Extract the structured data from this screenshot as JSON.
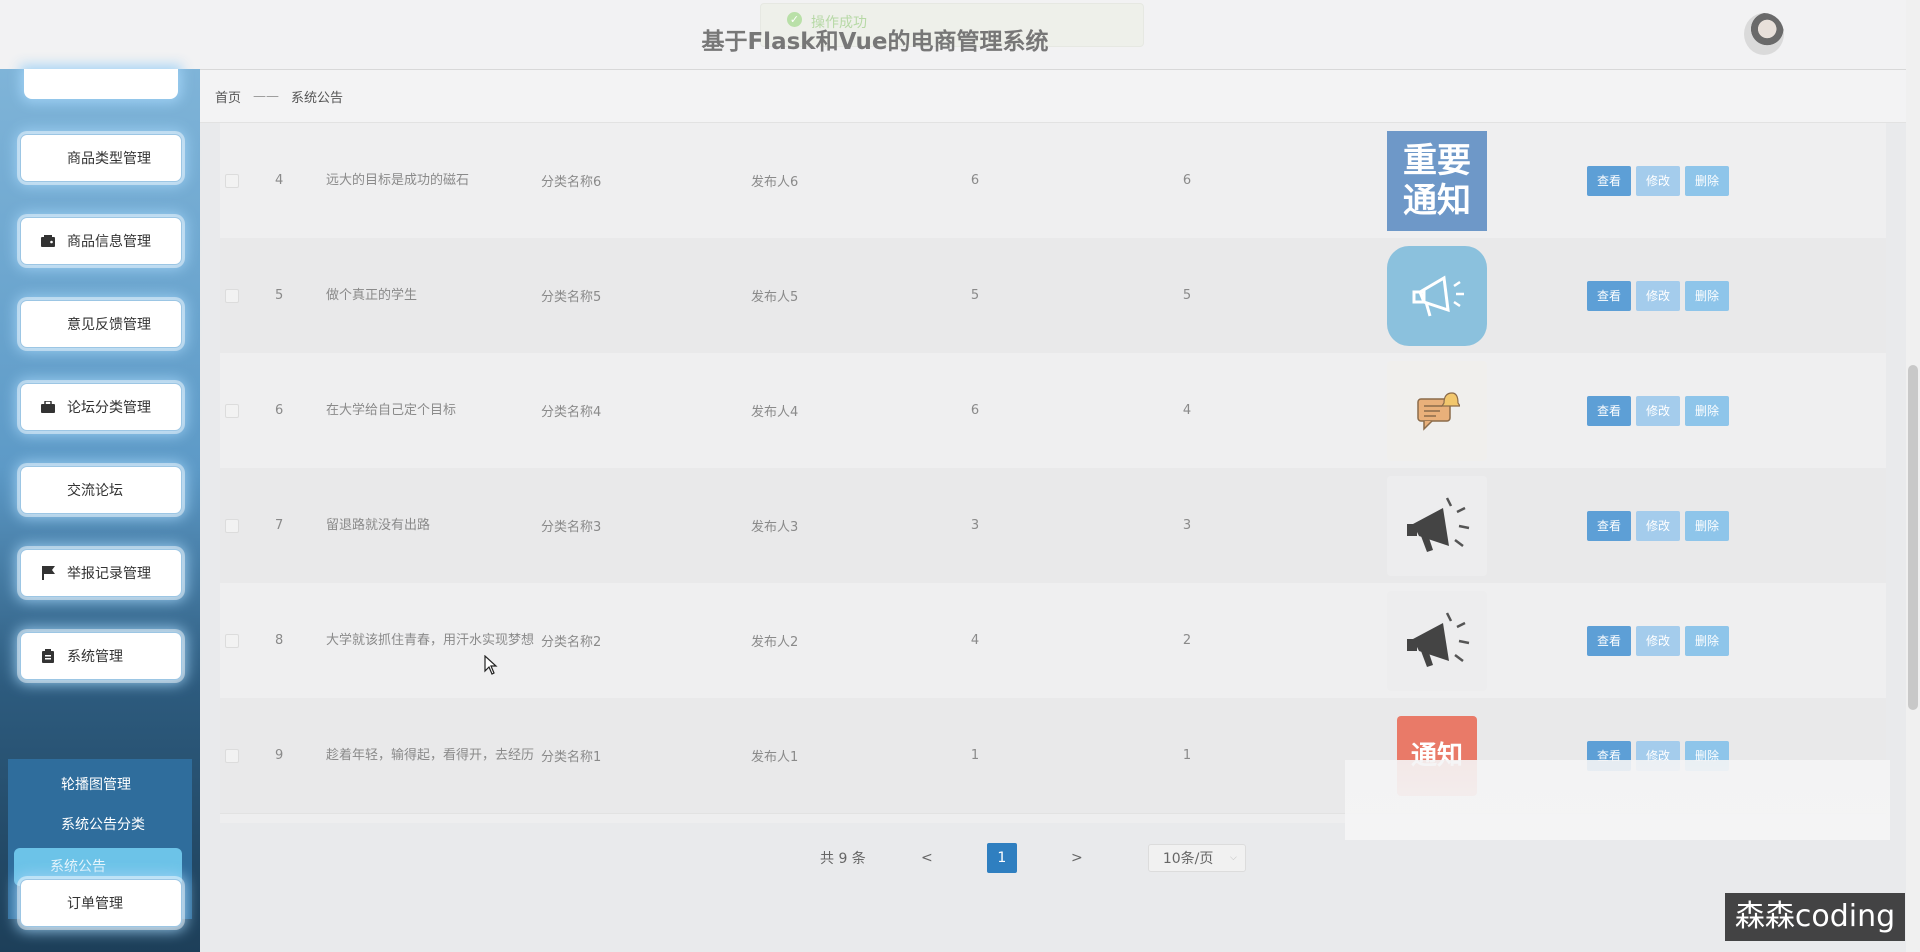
{
  "header": {
    "title": "基于Flask和Vue的电商管理系统",
    "toast_text": "操作成功"
  },
  "sidebar": {
    "menu": [
      {
        "label": "商品类型管理",
        "icon": "grid-icon"
      },
      {
        "label": "商品信息管理",
        "icon": "wallet-icon"
      },
      {
        "label": "意见反馈管理",
        "icon": "grid-icon"
      },
      {
        "label": "论坛分类管理",
        "icon": "briefcase-icon"
      },
      {
        "label": "交流论坛",
        "icon": "grid-icon"
      },
      {
        "label": "举报记录管理",
        "icon": "flag-icon"
      },
      {
        "label": "系统管理",
        "icon": "clipboard-icon"
      },
      {
        "label": "订单管理",
        "icon": "apps-icon"
      }
    ],
    "submenu": [
      {
        "label": "轮播图管理",
        "active": false
      },
      {
        "label": "系统公告分类",
        "active": false
      },
      {
        "label": "系统公告",
        "active": true
      }
    ]
  },
  "breadcrumb": {
    "home": "首页",
    "separator": "——",
    "current": "系统公告"
  },
  "table": {
    "rows": [
      {
        "index": "4",
        "title": "远大的目标是成功的磁石",
        "category": "分类名称6",
        "publisher": "发布人6",
        "n1": "6",
        "n2": "6",
        "image": "重要通知",
        "image_line1": "重要",
        "image_line2": "通知"
      },
      {
        "index": "5",
        "title": "做个真正的学生",
        "category": "分类名称5",
        "publisher": "发布人5",
        "n1": "5",
        "n2": "5",
        "image": "megaphone-blue"
      },
      {
        "index": "6",
        "title": "在大学给自己定个目标",
        "category": "分类名称4",
        "publisher": "发布人4",
        "n1": "6",
        "n2": "4",
        "image": "chat-bell"
      },
      {
        "index": "7",
        "title": "留退路就没有出路",
        "category": "分类名称3",
        "publisher": "发布人3",
        "n1": "3",
        "n2": "3",
        "image": "megaphone-gray"
      },
      {
        "index": "8",
        "title": "大学就该抓住青春，用汗水实现梦想",
        "category": "分类名称2",
        "publisher": "发布人2",
        "n1": "4",
        "n2": "2",
        "image": "megaphone-gray"
      },
      {
        "index": "9",
        "title": "趁着年轻，输得起，看得开，去经历",
        "category": "分类名称1",
        "publisher": "发布人1",
        "n1": "1",
        "n2": "1",
        "image": "通知",
        "image_line1": "通知"
      }
    ],
    "actions": {
      "view": "查看",
      "edit": "修改",
      "delete": "删除"
    }
  },
  "pagination": {
    "total": "共 9 条",
    "prev": "<",
    "current_page": "1",
    "next": ">",
    "page_size": "10条/页"
  },
  "watermark": "森森coding",
  "colors": {
    "primary": "#2f7fc0",
    "view_btn": "#5d9fd6",
    "edit_btn": "#a4ccec",
    "delete_btn": "#8ec5ea",
    "sidebar_active": "#6cc3e8"
  }
}
